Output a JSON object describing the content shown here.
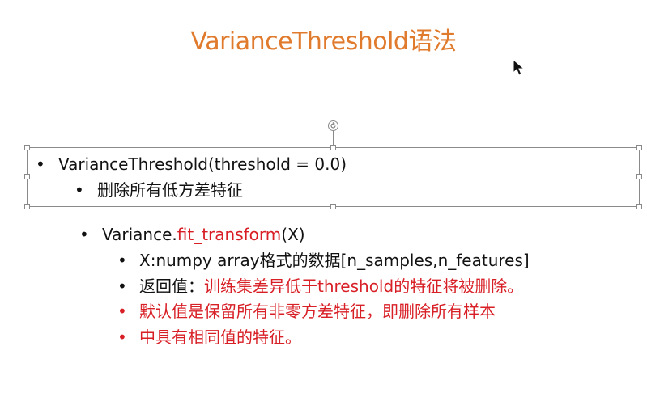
{
  "slide": {
    "title": "VarianceThreshold语法"
  },
  "textbox": {
    "line1": "VarianceThreshold(threshold = 0.0)",
    "line2": "删除所有低方差特征"
  },
  "body": {
    "fit_prefix": "Variance.",
    "fit_method": "fit_transform",
    "fit_args": "(X)",
    "x_desc": "X:numpy array格式的数据[n_samples,n_features]",
    "return_label": "返回值：",
    "return_text": "训练集差异低于threshold的特征将被删除。",
    "default_line1": "默认值是保留所有非零方差特征，即删除所有样本",
    "default_line2": "中具有相同值的特征。"
  },
  "bullet_glyph": "•",
  "colors": {
    "title": "#e07a2c",
    "emphasis": "#d81f26",
    "text": "#111111"
  }
}
